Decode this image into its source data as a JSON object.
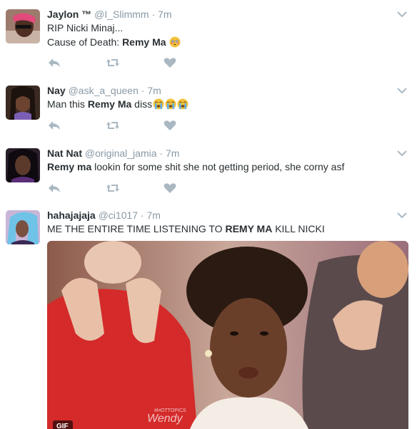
{
  "tweets": [
    {
      "name": "Jaylon ™",
      "handle": "@I_Slimmm",
      "sep": "·",
      "time": "7m",
      "line1": "RIP Nicki Minaj...",
      "line2_pre": "Cause of Death: ",
      "line2_bold": "Remy Ma",
      "emoji": "flushed-face"
    },
    {
      "name": "Nay",
      "handle": "@ask_a_queen",
      "sep": "·",
      "time": "7m",
      "pre": "Man this ",
      "bold": "Remy Ma",
      "post": " diss",
      "emoji": "loudly-crying-face x3"
    },
    {
      "name": "Nat Nat",
      "handle": "@original_jamia",
      "sep": "·",
      "time": "7m",
      "bold": "Remy ma",
      "post": " lookin for some shit she not getting period, she corny asf"
    },
    {
      "name": "hahajajaja",
      "handle": "@ci1017",
      "sep": "·",
      "time": "7m",
      "pre": "ME THE ENTIRE TIME LISTENING TO ",
      "bold": "REMY MA",
      "post": " KILL NICKI",
      "media": {
        "watermark_small": "#HOTTOPICS",
        "watermark": "Wendy",
        "badge": "GIF"
      }
    }
  ],
  "colors": {
    "icon": "#aab8c2",
    "handle": "#8899a6",
    "divider": "#e1e8ed"
  }
}
